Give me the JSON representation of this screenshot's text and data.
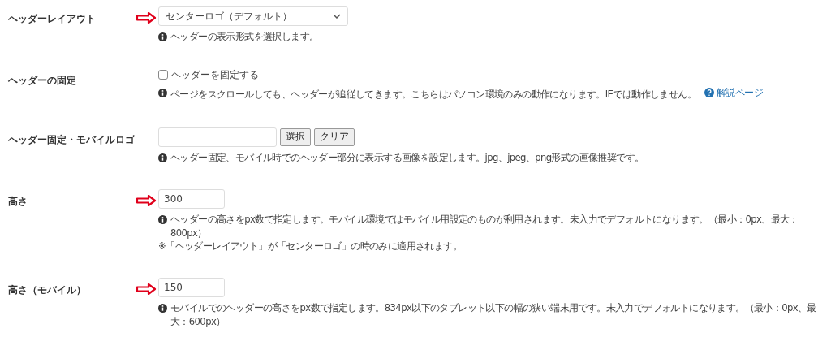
{
  "rows": [
    {
      "kind": "select",
      "label": "ヘッダーレイアウト",
      "marked": true,
      "value": "センターロゴ（デフォルト）",
      "help": "ヘッダーの表示形式を選択します。"
    },
    {
      "kind": "checkbox",
      "label": "ヘッダーの固定",
      "marked": false,
      "checkbox_label": "ヘッダーを固定する",
      "checked": false,
      "help": "ページをスクロールしても、ヘッダーが追従してきます。こちらはパソコン環境のみの動作になります。IEでは動作しません。",
      "link": "解説ページ"
    },
    {
      "kind": "image",
      "label": "ヘッダー固定・モバイルロゴ",
      "marked": false,
      "buttons": [
        "選択",
        "クリア"
      ],
      "help": "ヘッダー固定、モバイル時でのヘッダー部分に表示する画像を設定します。jpg、jpeg、png形式の画像推奨です。"
    },
    {
      "kind": "number",
      "label": "高さ",
      "marked": true,
      "value": "300",
      "help": "ヘッダーの高さをpx数で指定します。モバイル環境ではモバイル用設定のものが利用されます。未入力でデフォルトになります。（最小：0px、最大：800px）",
      "note": "※「ヘッダーレイアウト」が「センターロゴ」の時のみに適用されます。"
    },
    {
      "kind": "number",
      "label": "高さ（モバイル）",
      "marked": true,
      "value": "150",
      "help": "モバイルでのヘッダーの高さをpx数で指定します。834px以下のタブレット以下の幅の狭い端末用です。未入力でデフォルトになります。（最小：0px、最大：600px）"
    }
  ]
}
